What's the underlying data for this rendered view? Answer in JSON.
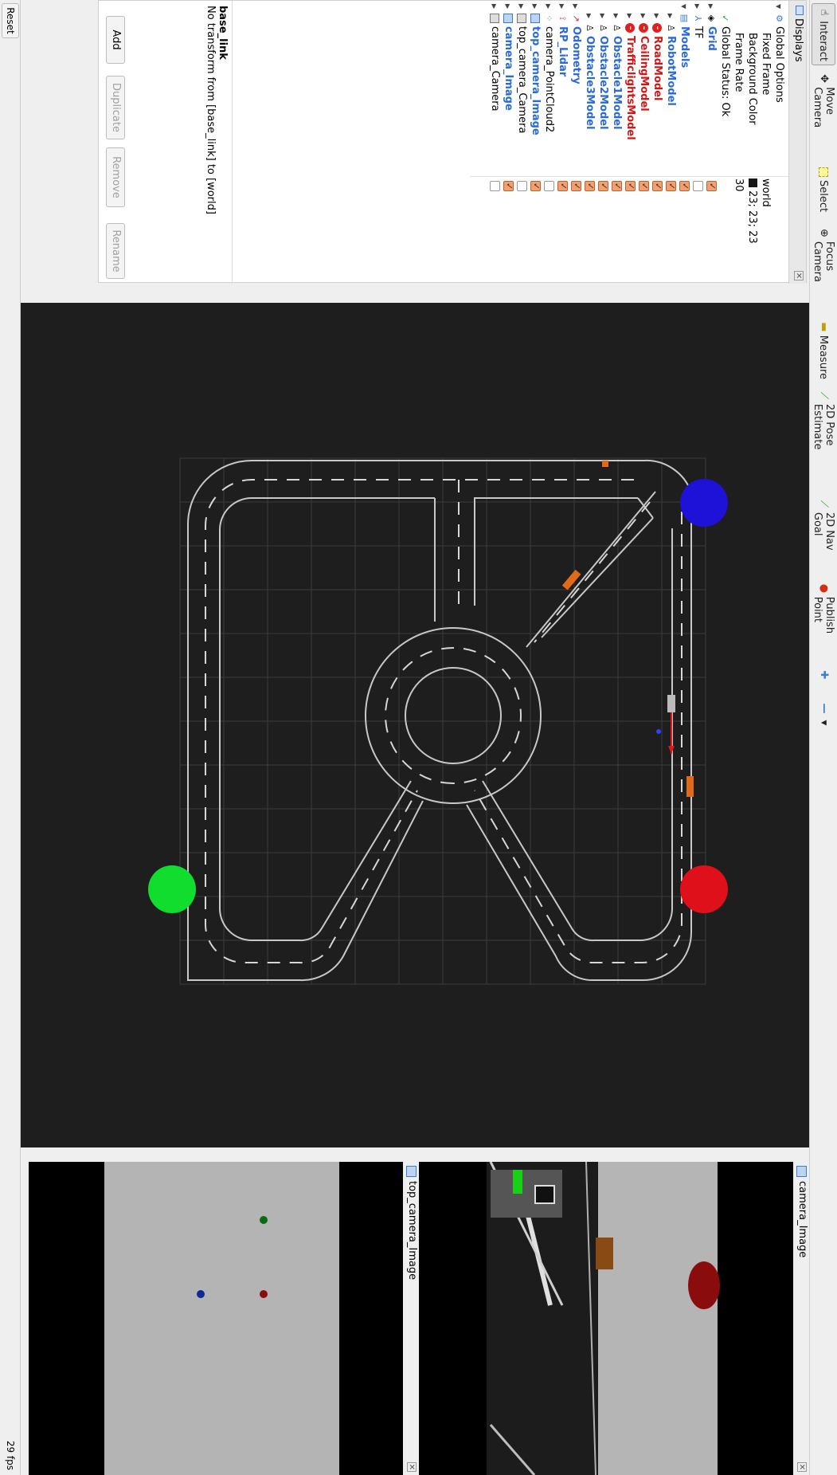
{
  "toolbar": {
    "interact": "Interact",
    "move_camera": "Move Camera",
    "select": "Select",
    "focus_camera": "Focus Camera",
    "measure": "Measure",
    "pose_estimate": "2D Pose Estimate",
    "nav_goal": "2D Nav Goal",
    "publish_point": "Publish Point"
  },
  "displays": {
    "title": "Displays",
    "global_options": "Global Options",
    "fixed_frame_label": "Fixed Frame",
    "fixed_frame_value": "world",
    "background_color_label": "Background Color",
    "background_color_value": "23; 23; 23",
    "frame_rate_label": "Frame Rate",
    "frame_rate_value": "30",
    "global_status": "Global Status: Ok",
    "grid": "Grid",
    "tf": "TF",
    "models": "Models",
    "robot_model": "RobotModel",
    "road_model": "RoadModel",
    "ceiling_model": "CeilingModel",
    "traffic_lights_model": "TrafficlightsModel",
    "obstacle1": "Obstacle1Model",
    "obstacle2": "Obstacle2Model",
    "obstacle3": "Obstacle3Model",
    "odometry": "Odometry",
    "rp_lidar": "RP_Lidar",
    "point_cloud": "camera_PointCloud2",
    "top_camera_image": "top_camera_Image",
    "top_camera_camera": "top_camera_Camera",
    "camera_image": "camera_Image",
    "camera_camera": "camera_Camera"
  },
  "status_box": {
    "title": "base_link",
    "message": "No transform from [base_link] to [world]"
  },
  "buttons": {
    "add": "Add",
    "duplicate": "Duplicate",
    "remove": "Remove",
    "rename": "Rename",
    "reset": "Reset"
  },
  "panels": {
    "camera_image_title": "camera_Image",
    "top_camera_image_title": "top_camera_Image"
  },
  "status": {
    "fps": "29 fps"
  },
  "colors": {
    "background": "#171717",
    "light_red": "#e0101a",
    "light_blue": "#1e12d8",
    "light_green": "#10dd2e",
    "obstacle": "#e06a1a"
  }
}
